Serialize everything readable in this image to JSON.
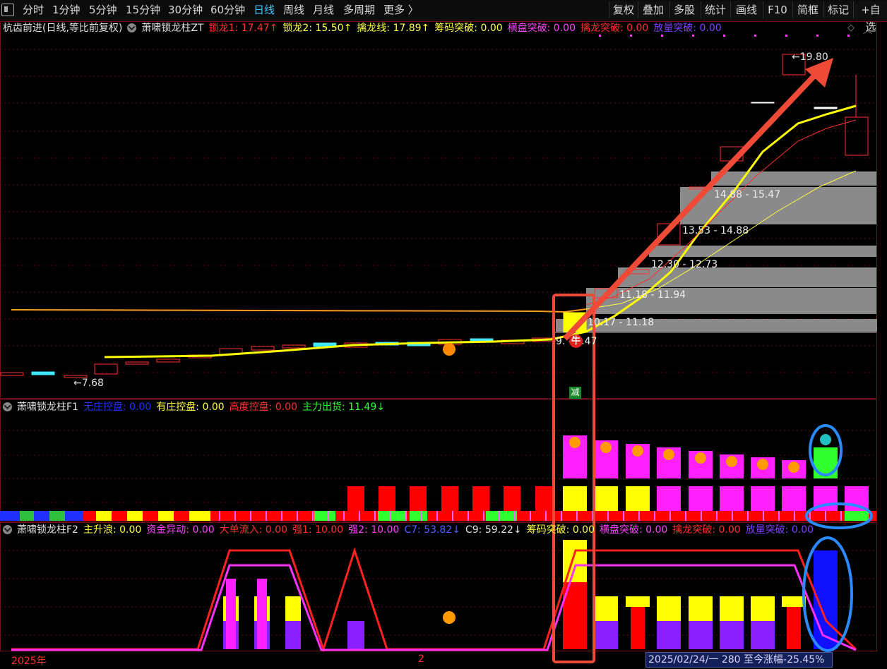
{
  "toolbar": {
    "periods": [
      "分时",
      "1分钟",
      "5分钟",
      "15分钟",
      "30分钟",
      "60分钟",
      "日线",
      "周线",
      "月线",
      "多周期",
      "更多 〉"
    ],
    "active_period": "日线",
    "right_buttons": [
      "复权",
      "叠加",
      "多股",
      "统计",
      "画线",
      "F10",
      "简框",
      "标记",
      "+自选"
    ]
  },
  "main_panel": {
    "stock_title": "杭齿前进(日线,等比前复权)",
    "indicator_name": "萧啸锁龙柱ZT",
    "values": [
      {
        "label": "锁龙1: 17.47↑",
        "color": "#ff3030"
      },
      {
        "label": "锁龙2: 15.50↑",
        "color": "#ffff40"
      },
      {
        "label": "擒龙线: 17.89↑",
        "color": "#ffff40"
      },
      {
        "label": "筹码突破: 0.00",
        "color": "#ffff40"
      },
      {
        "label": "横盘突破: 0.00",
        "color": "#ff40ff"
      },
      {
        "label": "擒龙突破: 0.00",
        "color": "#ff3030"
      },
      {
        "label": "放量突破: 0.00",
        "color": "#8040ff"
      }
    ],
    "price_high": "19.80",
    "price_low": "7.68",
    "zone_labels": [
      "14.88 - 15.47",
      "13.53 - 14.88",
      "12.30 - 12.73",
      "11.18 - 11.94",
      "10.17 - 11.18",
      "9.  - 9.47"
    ],
    "marker_niu": "牛",
    "marker_jian": "减"
  },
  "f1_panel": {
    "indicator_name": "萧啸锁龙柱F1",
    "values": [
      {
        "label": "无庄控盘: 0.00",
        "color": "#2030ff"
      },
      {
        "label": "有庄控盘: 0.00",
        "color": "#ffff40"
      },
      {
        "label": "高度控盘: 0.00",
        "color": "#ff3030"
      },
      {
        "label": "主力出货: 11.49↓",
        "color": "#30ff30"
      }
    ]
  },
  "f2_panel": {
    "indicator_name": "萧啸锁龙柱F2",
    "values": [
      {
        "label": "主升浪: 0.00",
        "color": "#ffff40"
      },
      {
        "label": "资金异动: 0.00",
        "color": "#ff40ff"
      },
      {
        "label": "大单流入: 0.00",
        "color": "#ff3030"
      },
      {
        "label": "强1: 10.00",
        "color": "#ff3030"
      },
      {
        "label": "强2: 10.00",
        "color": "#ff40ff"
      },
      {
        "label": "C7: 53.82↓",
        "color": "#5060ff"
      },
      {
        "label": "C9: 59.22↓",
        "color": "#e0e0e0"
      },
      {
        "label": "筹码突破: 0.00",
        "color": "#ffff40"
      },
      {
        "label": "横盘突破: 0.00",
        "color": "#ff40ff"
      },
      {
        "label": "擒龙突破: 0.00",
        "color": "#ff3030"
      },
      {
        "label": "放量突破: 0.00",
        "color": "#8040ff"
      }
    ]
  },
  "time_axis": {
    "year_label": "2025年",
    "month_label": "2",
    "status": "2025/02/24/一 280 至今涨幅-25.45%"
  }
}
